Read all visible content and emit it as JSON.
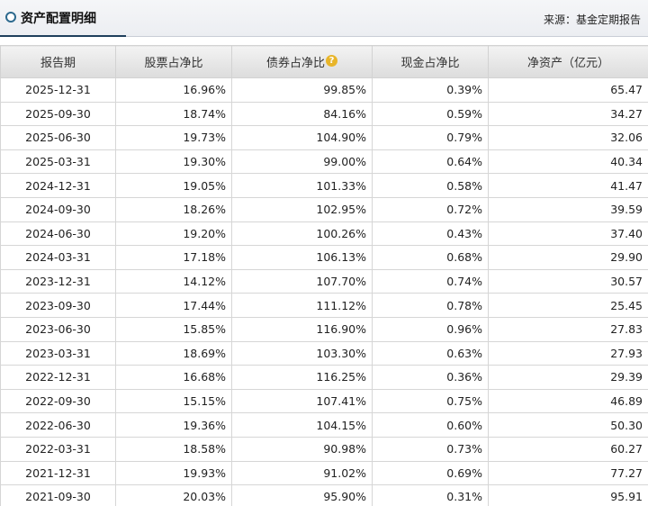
{
  "header": {
    "title": "资产配置明细",
    "source": "来源：基金定期报告"
  },
  "table": {
    "columns": [
      "报告期",
      "股票占净比",
      "债券占净比",
      "现金占净比",
      "净资产（亿元）"
    ],
    "rows": [
      [
        "2025-12-31",
        "16.96%",
        "99.85%",
        "0.39%",
        "65.47"
      ],
      [
        "2025-09-30",
        "18.74%",
        "84.16%",
        "0.59%",
        "34.27"
      ],
      [
        "2025-06-30",
        "19.73%",
        "104.90%",
        "0.79%",
        "32.06"
      ],
      [
        "2025-03-31",
        "19.30%",
        "99.00%",
        "0.64%",
        "40.34"
      ],
      [
        "2024-12-31",
        "19.05%",
        "101.33%",
        "0.58%",
        "41.47"
      ],
      [
        "2024-09-30",
        "18.26%",
        "102.95%",
        "0.72%",
        "39.59"
      ],
      [
        "2024-06-30",
        "19.20%",
        "100.26%",
        "0.43%",
        "37.40"
      ],
      [
        "2024-03-31",
        "17.18%",
        "106.13%",
        "0.68%",
        "29.90"
      ],
      [
        "2023-12-31",
        "14.12%",
        "107.70%",
        "0.74%",
        "30.57"
      ],
      [
        "2023-09-30",
        "17.44%",
        "111.12%",
        "0.78%",
        "25.45"
      ],
      [
        "2023-06-30",
        "15.85%",
        "116.90%",
        "0.96%",
        "27.83"
      ],
      [
        "2023-03-31",
        "18.69%",
        "103.30%",
        "0.63%",
        "27.93"
      ],
      [
        "2022-12-31",
        "16.68%",
        "116.25%",
        "0.36%",
        "29.39"
      ],
      [
        "2022-09-30",
        "15.15%",
        "107.41%",
        "0.75%",
        "46.89"
      ],
      [
        "2022-06-30",
        "19.36%",
        "104.15%",
        "0.60%",
        "50.30"
      ],
      [
        "2022-03-31",
        "18.58%",
        "90.98%",
        "0.73%",
        "60.27"
      ],
      [
        "2021-12-31",
        "19.93%",
        "91.02%",
        "0.69%",
        "77.27"
      ],
      [
        "2021-09-30",
        "20.03%",
        "95.90%",
        "0.31%",
        "95.91"
      ]
    ]
  },
  "icons": {
    "title": "circle-bullet-icon",
    "help": "question-help-icon",
    "help_glyph": "?"
  },
  "colors": {
    "title_accent": "#1f3f5c",
    "help_icon": "#e8b52a"
  }
}
